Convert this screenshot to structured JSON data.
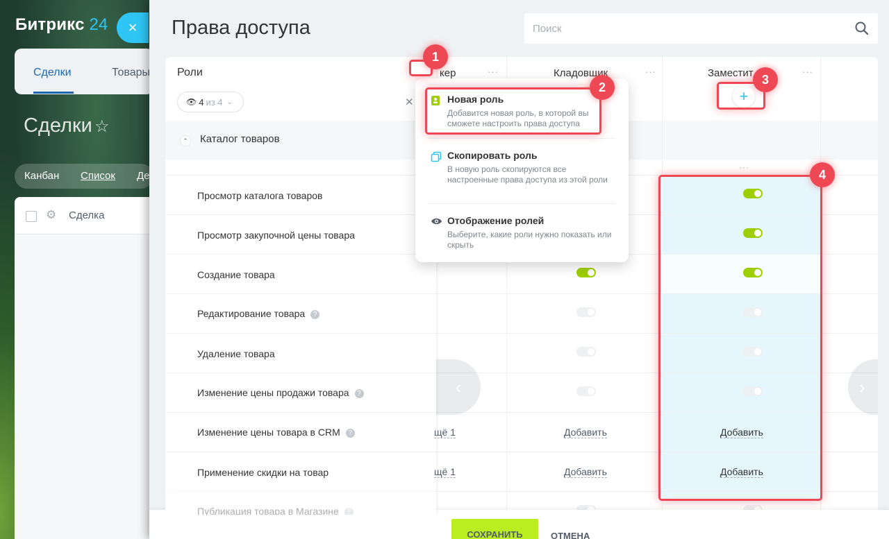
{
  "background": {
    "logo_text": "Битрикс",
    "logo_num": "24",
    "close_icon": "×",
    "tabs": [
      "Сделки",
      "Товары"
    ],
    "page_title": "Сделки",
    "views": [
      "Канбан",
      "Список",
      "Де"
    ],
    "list_column": "Сделка"
  },
  "slider": {
    "title": "Права доступа",
    "search_placeholder": "Поиск"
  },
  "roles_panel": {
    "title": "Роли",
    "count_current": "4",
    "count_total": "из 4",
    "section_title": "Каталог товаров"
  },
  "columns": [
    {
      "header": "кер"
    },
    {
      "header": "Кладовщик"
    },
    {
      "header": "Заместит"
    }
  ],
  "permissions": [
    {
      "label": "Просмотр каталога товаров",
      "help": false
    },
    {
      "label": "Просмотр закупочной цены товара",
      "help": false
    },
    {
      "label": "Создание товара",
      "help": false
    },
    {
      "label": "Редактирование товара",
      "help": true
    },
    {
      "label": "Удаление товара",
      "help": false
    },
    {
      "label": "Изменение цены продажи товара",
      "help": true
    },
    {
      "label": "Изменение цены товара в CRM",
      "help": true
    },
    {
      "label": "Применение скидки на товар",
      "help": false
    },
    {
      "label": "Публикация товара в Магазине",
      "help": true
    }
  ],
  "cells": {
    "more_text": "щё 1",
    "add_text": "Добавить"
  },
  "menu": {
    "new_role_title": "Новая роль",
    "new_role_desc": "Добавится новая роль, в которой вы сможете настроить права доступа",
    "copy_role_title": "Скопировать роль",
    "copy_role_desc": "В новую роль скопируются все настроенные права доступа из этой роли",
    "display_roles_title": "Отображение ролей",
    "display_roles_desc": "Выберите, какие роли нужно показать или скрыть"
  },
  "badges": [
    "1",
    "2",
    "3",
    "4"
  ],
  "footer": {
    "save": "СОХРАНИТЬ",
    "cancel": "ОТМЕНА"
  },
  "colors": {
    "accent": "#2fc6f6",
    "toggle_on": "#9dcf00",
    "highlight": "#ee4855",
    "save_button": "#bbed21"
  }
}
